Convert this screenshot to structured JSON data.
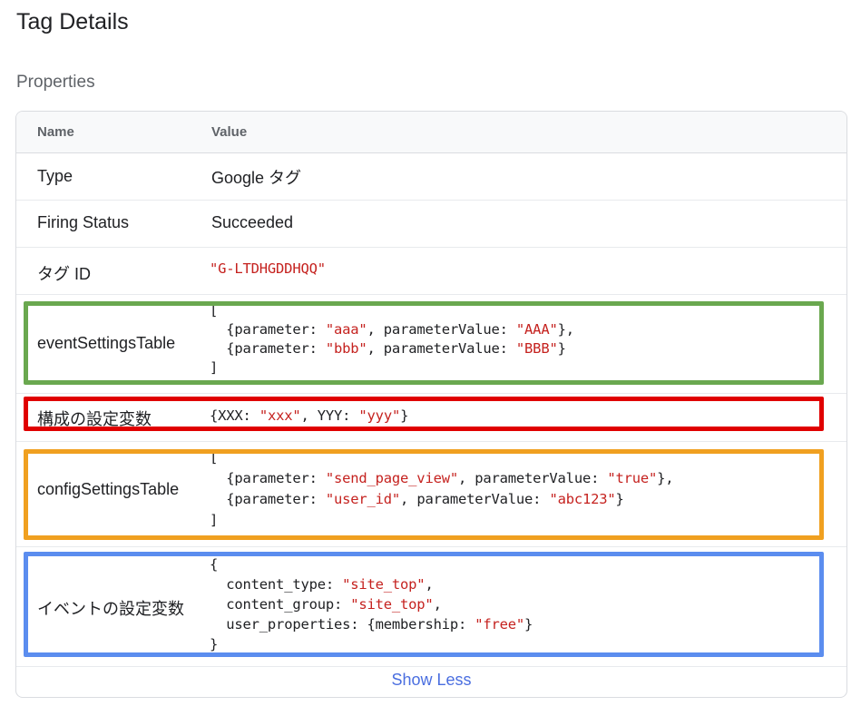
{
  "page_title": "Tag Details",
  "section_title": "Properties",
  "table": {
    "headers": {
      "name": "Name",
      "value": "Value"
    },
    "type": {
      "name": "Type",
      "value": "Google タグ"
    },
    "firing_status": {
      "name": "Firing Status",
      "value": "Succeeded"
    },
    "tag_id": {
      "name": "タグ ID",
      "value": "\"G-LTDHGDDHQQ\""
    },
    "event_settings": {
      "name": "eventSettingsTable",
      "open": "[",
      "items": [
        {
          "parameter": "\"aaa\"",
          "value": "\"AAA\"",
          "trail": "},"
        },
        {
          "parameter": "\"bbb\"",
          "value": "\"BBB\"",
          "trail": "}"
        }
      ],
      "close": "]"
    },
    "config_vars": {
      "name": "構成の設定変数",
      "pairs": [
        {
          "key": "XXX",
          "value": "\"xxx\""
        },
        {
          "key": "YYY",
          "value": "\"yyy\""
        }
      ]
    },
    "config_settings": {
      "name": "configSettingsTable",
      "open": "[",
      "items": [
        {
          "parameter": "\"send_page_view\"",
          "value": "\"true\"",
          "trail": "},"
        },
        {
          "parameter": "\"user_id\"",
          "value": "\"abc123\"",
          "trail": "}"
        }
      ],
      "close": "]"
    },
    "event_vars": {
      "name": "イベントの設定変数",
      "open": "{",
      "content_type_key": "content_type",
      "content_type": "\"site_top\"",
      "content_group_key": "content_group",
      "content_group": "\"site_top\"",
      "user_properties_key": "user_properties",
      "membership_key": "membership",
      "membership": "\"free\"",
      "close": "}"
    }
  },
  "show_less": "Show Less",
  "highlight_colors": {
    "green": "#6aa84f",
    "red": "#e00000",
    "orange": "#f0a020",
    "blue": "#5b8def"
  },
  "code_keywords": {
    "parameter": "parameter",
    "parameterValue": "parameterValue"
  }
}
